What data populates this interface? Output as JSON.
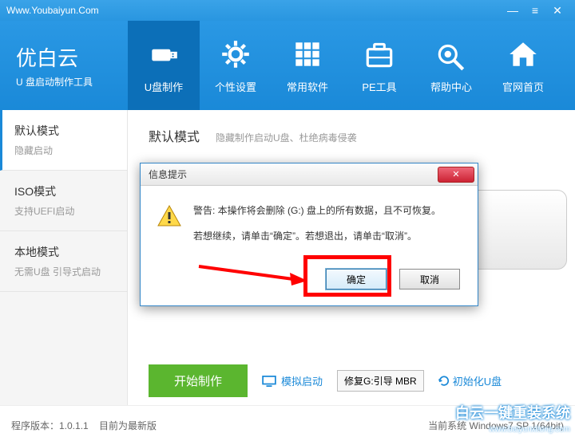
{
  "titlebar": {
    "url": "Www.Youbaiyun.Com"
  },
  "brand": {
    "title": "优白云",
    "sub": "U 盘启动制作工具"
  },
  "nav": [
    {
      "label": "U盘制作",
      "icon": "usb"
    },
    {
      "label": "个性设置",
      "icon": "gear"
    },
    {
      "label": "常用软件",
      "icon": "grid"
    },
    {
      "label": "PE工具",
      "icon": "briefcase"
    },
    {
      "label": "帮助中心",
      "icon": "help"
    },
    {
      "label": "官网首页",
      "icon": "home"
    }
  ],
  "sidebar": [
    {
      "title": "默认模式",
      "sub": "隐藏启动"
    },
    {
      "title": "ISO模式",
      "sub": "支持UEFI启动"
    },
    {
      "title": "本地模式",
      "sub": "无需U盘 引导式启动"
    }
  ],
  "main": {
    "title": "默认模式",
    "sub": "隐藏制作启动U盘、杜绝病毒侵袭"
  },
  "actions": {
    "start": "开始制作",
    "sim": "模拟启动",
    "repair": "修复G:引导 MBR",
    "init": "初始化U盘"
  },
  "dialog": {
    "title": "信息提示",
    "line1": "警告: 本操作将会删除 (G:) 盘上的所有数据，且不可恢复。",
    "line2": "若想继续，请单击“确定”。若想退出，请单击“取消”。",
    "ok": "确定",
    "cancel": "取消"
  },
  "footer": {
    "version": "程序版本：1.0.1.1",
    "status": "目前为最新版",
    "sys": "当前系统 Windows7 SP 1(64bit)"
  },
  "watermark": {
    "main": "白云一键重装系统",
    "sub": "www.baiyunxitong.com"
  }
}
